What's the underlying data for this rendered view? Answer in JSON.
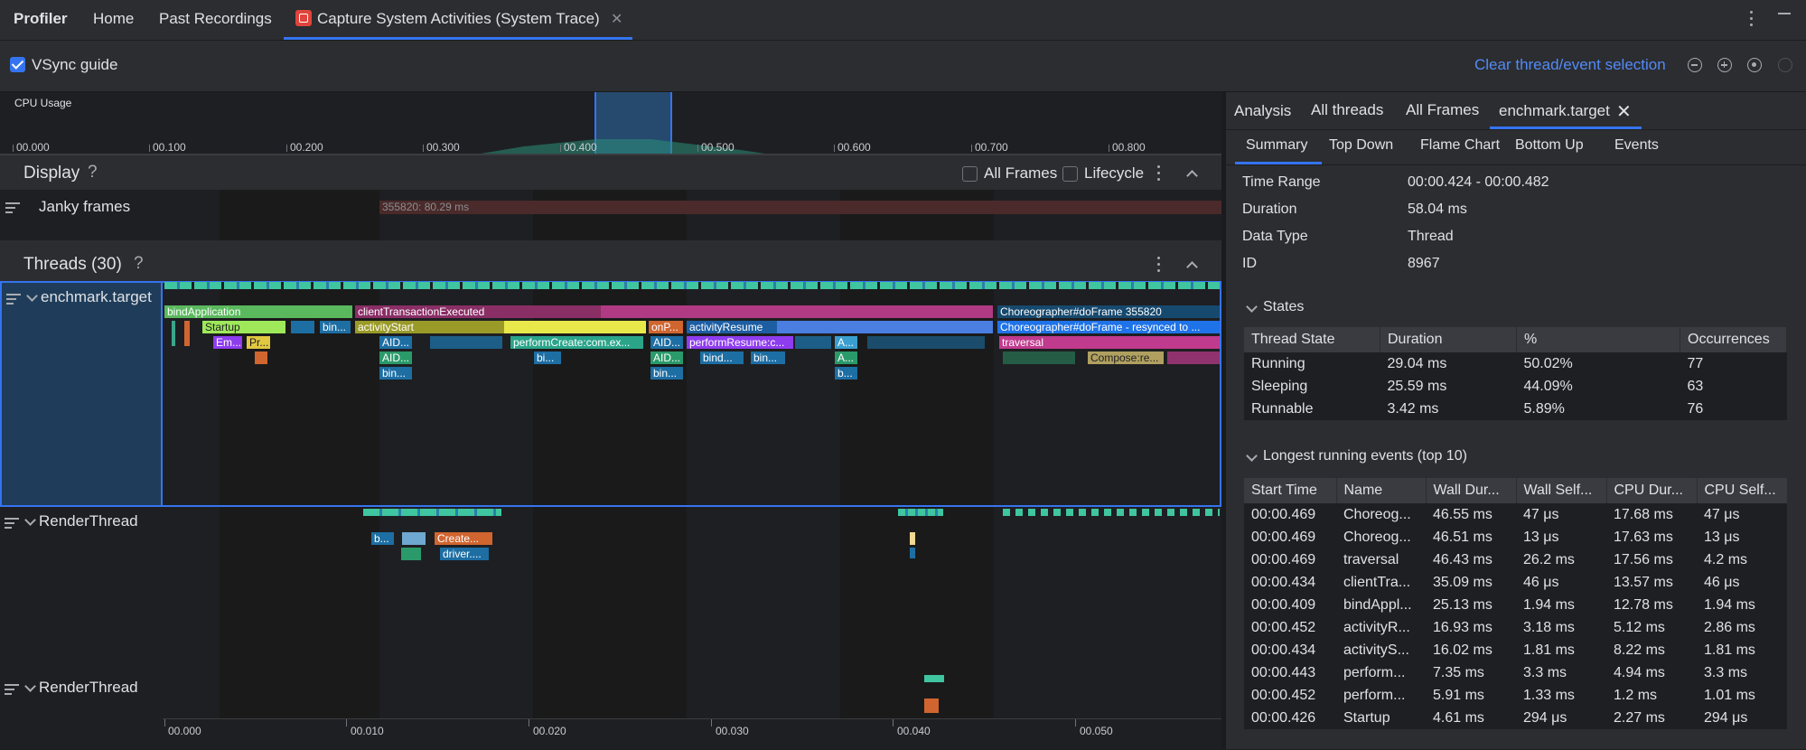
{
  "app": {
    "title": "Profiler"
  },
  "tabs": [
    {
      "label": "Home"
    },
    {
      "label": "Past Recordings"
    },
    {
      "label": "Capture System Activities (System Trace)"
    }
  ],
  "toolbar": {
    "vsync_label": "VSync guide",
    "clear_label": "Clear thread/event selection"
  },
  "cpu": {
    "label": "CPU Usage",
    "ticks": [
      "00.000",
      "00.100",
      "00.200",
      "00.300",
      "00.400",
      "00.500",
      "00.600",
      "00.700",
      "00.800"
    ]
  },
  "display": {
    "title": "Display",
    "all_frames": "All Frames",
    "lifecycle": "Lifecycle",
    "janky_label": "Janky frames",
    "janky_event": "355820: 80.29 ms"
  },
  "threads": {
    "title": "Threads (30)",
    "main_label": "enchmark.target",
    "render1_label": "RenderThread",
    "render2_label": "RenderThread",
    "events": {
      "bindApplication": "bindApplication",
      "clientTransactionExecuted": "clientTransactionExecuted",
      "choreographer": "Choreographer#doFrame 355820",
      "startup": "Startup",
      "bin1": "bin...",
      "activityStart": "activityStart",
      "onP": "onP...",
      "activityResume": "activityResume",
      "choreo_resync": "Choreographer#doFrame - resynced to ...",
      "em": "Em...",
      "pr": "Pr...",
      "aid1": "AID...",
      "performCreate": "performCreate:com.ex...",
      "aid2": "AID...",
      "performResume": "performResume:c...",
      "a1": "A...",
      "traversal": "traversal",
      "aid3": "AID...",
      "bi": "bi...",
      "aid4": "AID...",
      "bind": "bind...",
      "bin2": "bin...",
      "a2": "A...",
      "compose": "Compose:re...",
      "bin3": "bin...",
      "bin4": "bin...",
      "b1": "b...",
      "rt_b": "b...",
      "rt_create": "Create...",
      "rt_driver": "driver...."
    },
    "ticks": [
      "00.000",
      "00.010",
      "00.020",
      "00.030",
      "00.040",
      "00.050"
    ]
  },
  "panel": {
    "tabs": [
      "Analysis",
      "All threads",
      "All Frames",
      "enchmark.target"
    ],
    "subtabs": [
      "Summary",
      "Top Down",
      "Flame Chart",
      "Bottom Up",
      "Events"
    ],
    "summary": [
      {
        "k": "Time Range",
        "v": "00:00.424 - 00:00.482"
      },
      {
        "k": "Duration",
        "v": "58.04 ms"
      },
      {
        "k": "Data Type",
        "v": "Thread"
      },
      {
        "k": "ID",
        "v": "8967"
      }
    ],
    "states_title": "States",
    "states_headers": [
      "Thread State",
      "Duration",
      "%",
      "Occurrences"
    ],
    "states_rows": [
      [
        "Running",
        "29.04 ms",
        "50.02%",
        "77"
      ],
      [
        "Sleeping",
        "25.59 ms",
        "44.09%",
        "63"
      ],
      [
        "Runnable",
        "3.42 ms",
        "5.89%",
        "76"
      ]
    ],
    "longest_title": "Longest running events (top 10)",
    "longest_headers": [
      "Start Time",
      "Name",
      "Wall Dur...",
      "Wall Self...",
      "CPU Dur...",
      "CPU Self..."
    ],
    "longest_rows": [
      [
        "00:00.469",
        "Choreog...",
        "46.55 ms",
        "47 μs",
        "17.68 ms",
        "47 μs"
      ],
      [
        "00:00.469",
        "Choreog...",
        "46.51 ms",
        "13 μs",
        "17.63 ms",
        "13 μs"
      ],
      [
        "00:00.469",
        "traversal",
        "46.43 ms",
        "26.2 ms",
        "17.56 ms",
        "4.2 ms"
      ],
      [
        "00:00.434",
        "clientTra...",
        "35.09 ms",
        "46 μs",
        "13.57 ms",
        "46 μs"
      ],
      [
        "00:00.409",
        "bindAppl...",
        "25.13 ms",
        "1.94 ms",
        "12.78 ms",
        "1.94 ms"
      ],
      [
        "00:00.452",
        "activityR...",
        "16.93 ms",
        "3.18 ms",
        "5.12 ms",
        "2.86 ms"
      ],
      [
        "00:00.434",
        "activityS...",
        "16.02 ms",
        "1.81 ms",
        "8.22 ms",
        "1.81 ms"
      ],
      [
        "00:00.443",
        "perform...",
        "7.35 ms",
        "3.3 ms",
        "4.94 ms",
        "3.3 ms"
      ],
      [
        "00:00.452",
        "perform...",
        "5.91 ms",
        "1.33 ms",
        "1.2 ms",
        "1.01 ms"
      ],
      [
        "00:00.426",
        "Startup",
        "4.61 ms",
        "294 μs",
        "2.27 ms",
        "294 μs"
      ]
    ]
  },
  "colors": {
    "accent": "#3574f0",
    "link": "#548af7",
    "bg": "#1e1f22",
    "panel": "#2b2d30"
  }
}
